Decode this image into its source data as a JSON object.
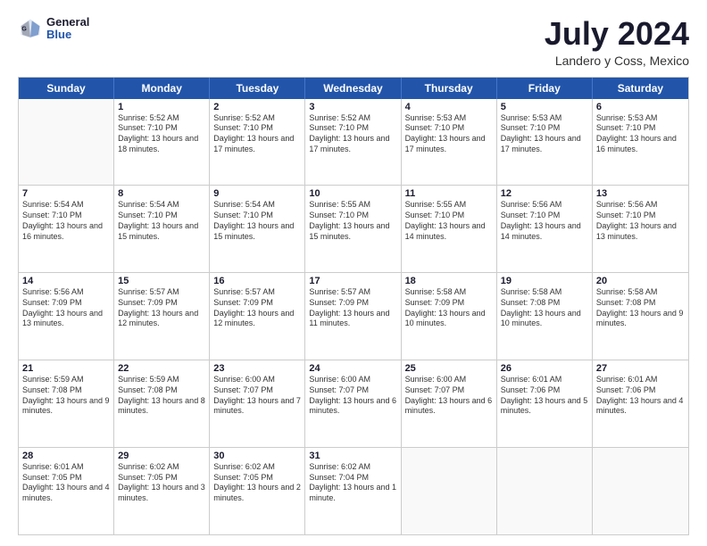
{
  "logo": {
    "line1": "General",
    "line2": "Blue"
  },
  "title": {
    "month_year": "July 2024",
    "location": "Landero y Coss, Mexico"
  },
  "calendar": {
    "days_of_week": [
      "Sunday",
      "Monday",
      "Tuesday",
      "Wednesday",
      "Thursday",
      "Friday",
      "Saturday"
    ],
    "weeks": [
      [
        {
          "day": "",
          "sunrise": "",
          "sunset": "",
          "daylight": ""
        },
        {
          "day": "1",
          "sunrise": "Sunrise: 5:52 AM",
          "sunset": "Sunset: 7:10 PM",
          "daylight": "Daylight: 13 hours and 18 minutes."
        },
        {
          "day": "2",
          "sunrise": "Sunrise: 5:52 AM",
          "sunset": "Sunset: 7:10 PM",
          "daylight": "Daylight: 13 hours and 17 minutes."
        },
        {
          "day": "3",
          "sunrise": "Sunrise: 5:52 AM",
          "sunset": "Sunset: 7:10 PM",
          "daylight": "Daylight: 13 hours and 17 minutes."
        },
        {
          "day": "4",
          "sunrise": "Sunrise: 5:53 AM",
          "sunset": "Sunset: 7:10 PM",
          "daylight": "Daylight: 13 hours and 17 minutes."
        },
        {
          "day": "5",
          "sunrise": "Sunrise: 5:53 AM",
          "sunset": "Sunset: 7:10 PM",
          "daylight": "Daylight: 13 hours and 17 minutes."
        },
        {
          "day": "6",
          "sunrise": "Sunrise: 5:53 AM",
          "sunset": "Sunset: 7:10 PM",
          "daylight": "Daylight: 13 hours and 16 minutes."
        }
      ],
      [
        {
          "day": "7",
          "sunrise": "Sunrise: 5:54 AM",
          "sunset": "Sunset: 7:10 PM",
          "daylight": "Daylight: 13 hours and 16 minutes."
        },
        {
          "day": "8",
          "sunrise": "Sunrise: 5:54 AM",
          "sunset": "Sunset: 7:10 PM",
          "daylight": "Daylight: 13 hours and 15 minutes."
        },
        {
          "day": "9",
          "sunrise": "Sunrise: 5:54 AM",
          "sunset": "Sunset: 7:10 PM",
          "daylight": "Daylight: 13 hours and 15 minutes."
        },
        {
          "day": "10",
          "sunrise": "Sunrise: 5:55 AM",
          "sunset": "Sunset: 7:10 PM",
          "daylight": "Daylight: 13 hours and 15 minutes."
        },
        {
          "day": "11",
          "sunrise": "Sunrise: 5:55 AM",
          "sunset": "Sunset: 7:10 PM",
          "daylight": "Daylight: 13 hours and 14 minutes."
        },
        {
          "day": "12",
          "sunrise": "Sunrise: 5:56 AM",
          "sunset": "Sunset: 7:10 PM",
          "daylight": "Daylight: 13 hours and 14 minutes."
        },
        {
          "day": "13",
          "sunrise": "Sunrise: 5:56 AM",
          "sunset": "Sunset: 7:10 PM",
          "daylight": "Daylight: 13 hours and 13 minutes."
        }
      ],
      [
        {
          "day": "14",
          "sunrise": "Sunrise: 5:56 AM",
          "sunset": "Sunset: 7:09 PM",
          "daylight": "Daylight: 13 hours and 13 minutes."
        },
        {
          "day": "15",
          "sunrise": "Sunrise: 5:57 AM",
          "sunset": "Sunset: 7:09 PM",
          "daylight": "Daylight: 13 hours and 12 minutes."
        },
        {
          "day": "16",
          "sunrise": "Sunrise: 5:57 AM",
          "sunset": "Sunset: 7:09 PM",
          "daylight": "Daylight: 13 hours and 12 minutes."
        },
        {
          "day": "17",
          "sunrise": "Sunrise: 5:57 AM",
          "sunset": "Sunset: 7:09 PM",
          "daylight": "Daylight: 13 hours and 11 minutes."
        },
        {
          "day": "18",
          "sunrise": "Sunrise: 5:58 AM",
          "sunset": "Sunset: 7:09 PM",
          "daylight": "Daylight: 13 hours and 10 minutes."
        },
        {
          "day": "19",
          "sunrise": "Sunrise: 5:58 AM",
          "sunset": "Sunset: 7:08 PM",
          "daylight": "Daylight: 13 hours and 10 minutes."
        },
        {
          "day": "20",
          "sunrise": "Sunrise: 5:58 AM",
          "sunset": "Sunset: 7:08 PM",
          "daylight": "Daylight: 13 hours and 9 minutes."
        }
      ],
      [
        {
          "day": "21",
          "sunrise": "Sunrise: 5:59 AM",
          "sunset": "Sunset: 7:08 PM",
          "daylight": "Daylight: 13 hours and 9 minutes."
        },
        {
          "day": "22",
          "sunrise": "Sunrise: 5:59 AM",
          "sunset": "Sunset: 7:08 PM",
          "daylight": "Daylight: 13 hours and 8 minutes."
        },
        {
          "day": "23",
          "sunrise": "Sunrise: 6:00 AM",
          "sunset": "Sunset: 7:07 PM",
          "daylight": "Daylight: 13 hours and 7 minutes."
        },
        {
          "day": "24",
          "sunrise": "Sunrise: 6:00 AM",
          "sunset": "Sunset: 7:07 PM",
          "daylight": "Daylight: 13 hours and 6 minutes."
        },
        {
          "day": "25",
          "sunrise": "Sunrise: 6:00 AM",
          "sunset": "Sunset: 7:07 PM",
          "daylight": "Daylight: 13 hours and 6 minutes."
        },
        {
          "day": "26",
          "sunrise": "Sunrise: 6:01 AM",
          "sunset": "Sunset: 7:06 PM",
          "daylight": "Daylight: 13 hours and 5 minutes."
        },
        {
          "day": "27",
          "sunrise": "Sunrise: 6:01 AM",
          "sunset": "Sunset: 7:06 PM",
          "daylight": "Daylight: 13 hours and 4 minutes."
        }
      ],
      [
        {
          "day": "28",
          "sunrise": "Sunrise: 6:01 AM",
          "sunset": "Sunset: 7:05 PM",
          "daylight": "Daylight: 13 hours and 4 minutes."
        },
        {
          "day": "29",
          "sunrise": "Sunrise: 6:02 AM",
          "sunset": "Sunset: 7:05 PM",
          "daylight": "Daylight: 13 hours and 3 minutes."
        },
        {
          "day": "30",
          "sunrise": "Sunrise: 6:02 AM",
          "sunset": "Sunset: 7:05 PM",
          "daylight": "Daylight: 13 hours and 2 minutes."
        },
        {
          "day": "31",
          "sunrise": "Sunrise: 6:02 AM",
          "sunset": "Sunset: 7:04 PM",
          "daylight": "Daylight: 13 hours and 1 minute."
        },
        {
          "day": "",
          "sunrise": "",
          "sunset": "",
          "daylight": ""
        },
        {
          "day": "",
          "sunrise": "",
          "sunset": "",
          "daylight": ""
        },
        {
          "day": "",
          "sunrise": "",
          "sunset": "",
          "daylight": ""
        }
      ]
    ]
  }
}
